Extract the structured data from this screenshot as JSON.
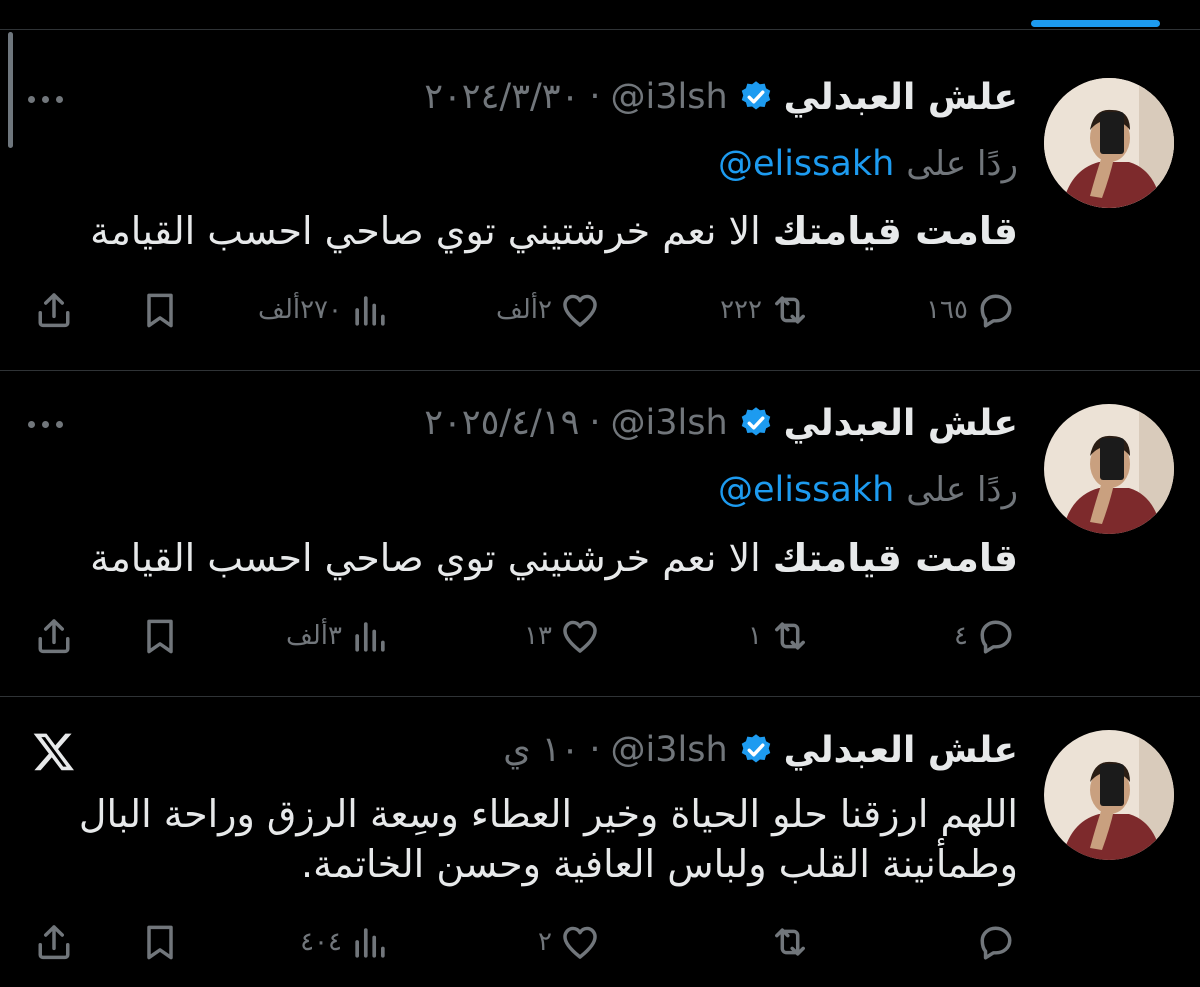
{
  "tweets": [
    {
      "name": "علش العبدلي",
      "handle": "@i3lsh",
      "separator": "·",
      "time": "٢٠٢٤/٣/٣٠",
      "reply_prefix": "ردًا على",
      "reply_to": "@elissakh",
      "text_bold": "قامت قيامتك",
      "text_rest": " الا نعم خرشتيني توي صاحي احسب القيامة",
      "replies": "١٦٥",
      "retweets": "٢٢٢",
      "likes": "٢ألف",
      "views": "٢٧٠ألف"
    },
    {
      "name": "علش العبدلي",
      "handle": "@i3lsh",
      "separator": "·",
      "time": "٢٠٢٥/٤/١٩",
      "reply_prefix": "ردًا على",
      "reply_to": "@elissakh",
      "text_bold": "قامت قيامتك",
      "text_rest": " الا نعم خرشتيني توي صاحي احسب القيامة",
      "replies": "٤",
      "retweets": "١",
      "likes": "١٣",
      "views": "٣ألف"
    },
    {
      "name": "علش العبدلي",
      "handle": "@i3lsh",
      "separator": "·",
      "time": "١٠ ي",
      "text_line1": "اللهم ارزقنا حلو الحياة وخير العطاء وسِعة الرزق وراحة البال",
      "text_line2": "وطمأنينة القلب ولباس العافية وحسن الخاتمة.",
      "replies": "",
      "retweets": "",
      "likes": "٢",
      "views": "٤٠٤"
    }
  ],
  "colors": {
    "background": "#000000",
    "text": "#e7e9ea",
    "secondary": "#71767b",
    "accent": "#1d9bf0",
    "divider": "#2f3336"
  },
  "icons": {
    "reply": "reply-icon",
    "retweet": "retweet-icon",
    "like": "heart-icon",
    "views": "views-icon",
    "bookmark": "bookmark-icon",
    "share": "share-icon",
    "more": "more-icon",
    "verified": "verified-badge-icon",
    "brand": "x-logo-icon"
  }
}
